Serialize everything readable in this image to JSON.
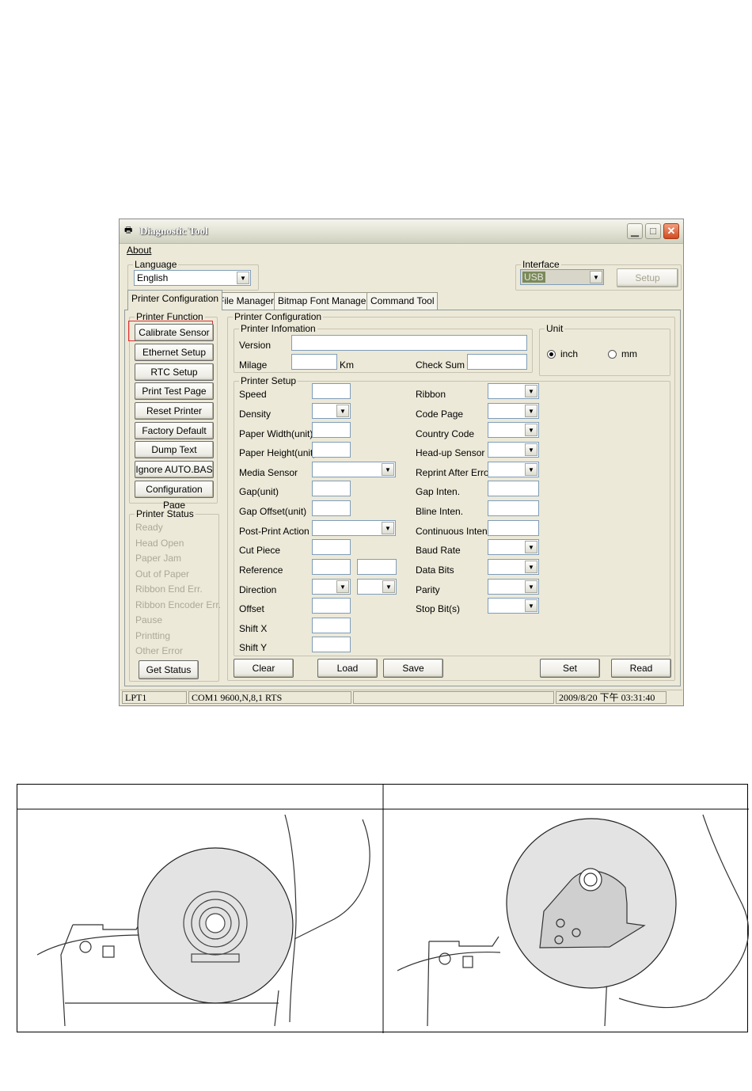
{
  "window": {
    "title": "Diagnostic Tool",
    "caption_buttons": [
      "minimize",
      "maximize",
      "close"
    ]
  },
  "menu": {
    "about": "About"
  },
  "language": {
    "legend": "Language",
    "selected": "English"
  },
  "interface": {
    "legend": "Interface",
    "selected": "USB",
    "setup_button": "Setup"
  },
  "tabs": [
    {
      "label": "Printer Configuration",
      "active": true
    },
    {
      "label": "File Manager"
    },
    {
      "label": "Bitmap Font Manager"
    },
    {
      "label": "Command Tool"
    }
  ],
  "printer_function": {
    "legend": "Printer Function",
    "buttons": [
      "Calibrate Sensor",
      "Ethernet Setup",
      "RTC Setup",
      "Print Test Page",
      "Reset Printer",
      "Factory Default",
      "Dump Text",
      "Ignore AUTO.BAS",
      "Configuration Page"
    ],
    "highlight_color": "#e03030"
  },
  "printer_status": {
    "legend": "Printer Status",
    "items": [
      "Ready",
      "Head Open",
      "Paper Jam",
      "Out of Paper",
      "Ribbon End Err.",
      "Ribbon Encoder Err.",
      "Pause",
      "Printting",
      "Other Error"
    ],
    "button": "Get Status"
  },
  "printer_configuration": {
    "legend": "Printer Configuration",
    "info": {
      "legend": "Printer Infomation",
      "version": "Version",
      "milage": "Milage",
      "km": "Km",
      "check_sum": "Check Sum"
    },
    "unit": {
      "legend": "Unit",
      "inch": "inch",
      "mm": "mm",
      "selected": "inch"
    },
    "setup": {
      "legend": "Printer Setup",
      "left": [
        "Speed",
        "Density",
        "Paper Width(unit)",
        "Paper Height(unit)",
        "Media Sensor",
        "Gap(unit)",
        "Gap Offset(unit)",
        "Post-Print Action",
        "Cut Piece",
        "Reference",
        "Direction",
        "Offset",
        "Shift X",
        "Shift Y"
      ],
      "right": [
        "Ribbon",
        "Code Page",
        "Country Code",
        "Head-up Sensor",
        "Reprint After Error",
        "Gap Inten.",
        "Bline Inten.",
        "Continuous Inten.",
        "Baud Rate",
        "Data Bits",
        "Parity",
        "Stop Bit(s)"
      ]
    },
    "buttons": {
      "clear": "Clear",
      "load": "Load",
      "save": "Save",
      "set": "Set",
      "read": "Read"
    }
  },
  "status_bar": {
    "port": "LPT1",
    "com": "COM1 9600,N,8,1 RTS",
    "datetime": "2009/8/20 下午 03:31:40"
  }
}
